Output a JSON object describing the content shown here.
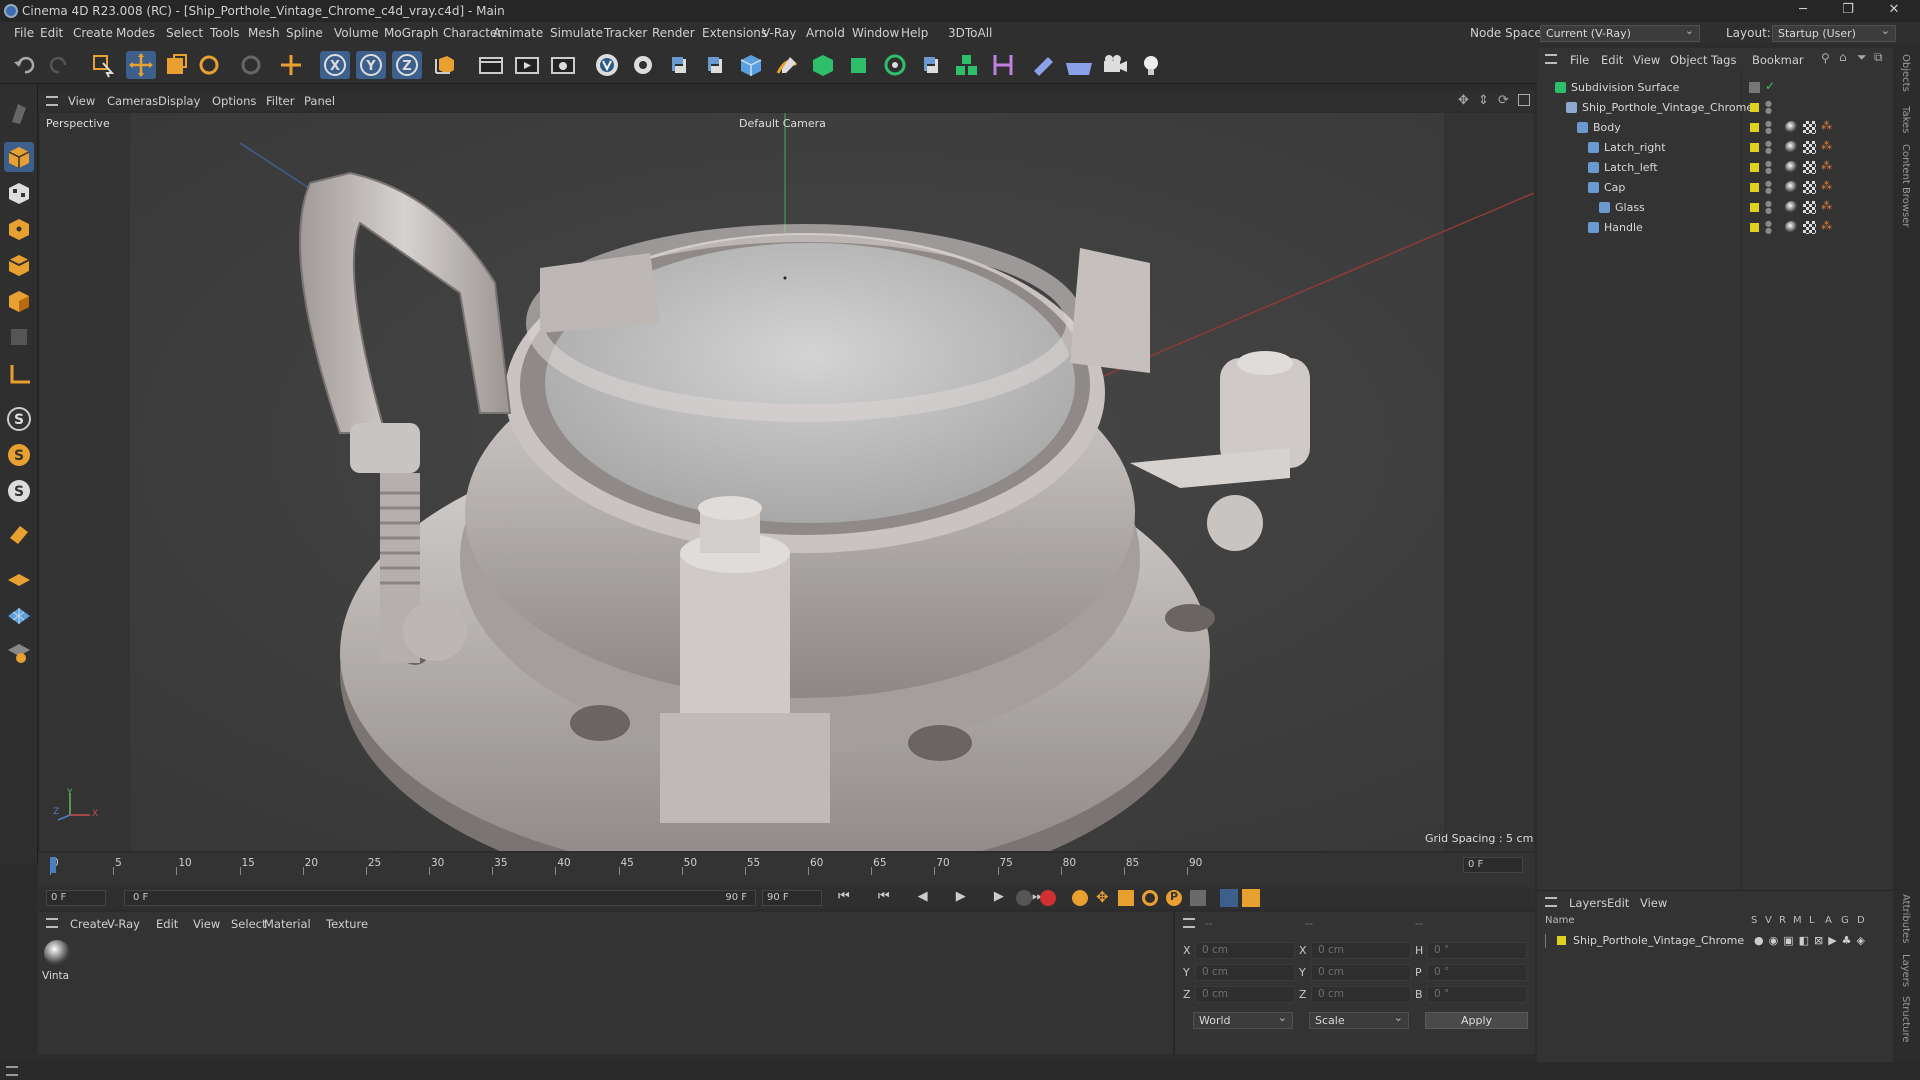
{
  "window": {
    "title": "Cinema 4D R23.008 (RC) - [Ship_Porthole_Vintage_Chrome_c4d_vray.c4d] - Main"
  },
  "menu": [
    "File",
    "Edit",
    "Create",
    "Modes",
    "Select",
    "Tools",
    "Mesh",
    "Spline",
    "Volume",
    "MoGraph",
    "Character",
    "Animate",
    "Simulate",
    "Tracker",
    "Render",
    "Extensions",
    "V-Ray",
    "Arnold",
    "Window",
    "Help",
    "3DToAll"
  ],
  "node_space": {
    "label": "Node Space:",
    "value": "Current (V-Ray)"
  },
  "layout": {
    "label": "Layout:",
    "value": "Startup (User)"
  },
  "viewport": {
    "menu": [
      "View",
      "Cameras",
      "Display",
      "Options",
      "Filter",
      "Panel"
    ],
    "view_name": "Perspective",
    "camera": "Default Camera",
    "grid_spacing": "Grid Spacing : 5 cm",
    "axis": {
      "x": "X",
      "y": "Y",
      "z": "Z"
    }
  },
  "objects": {
    "menu": [
      "File",
      "Edit",
      "View",
      "Object",
      "Tags",
      "Bookmar"
    ],
    "items": [
      {
        "name": "Subdivision Surface",
        "level": 0
      },
      {
        "name": "Ship_Porthole_Vintage_Chrome",
        "level": 1
      },
      {
        "name": "Body",
        "level": 2
      },
      {
        "name": "Latch_right",
        "level": 3
      },
      {
        "name": "Latch_left",
        "level": 3
      },
      {
        "name": "Cap",
        "level": 3
      },
      {
        "name": "Glass",
        "level": 4
      },
      {
        "name": "Handle",
        "level": 3
      }
    ]
  },
  "timeline": {
    "ticks": [
      "0",
      "5",
      "10",
      "15",
      "20",
      "25",
      "30",
      "35",
      "40",
      "45",
      "50",
      "55",
      "60",
      "65",
      "70",
      "75",
      "80",
      "85",
      "90"
    ],
    "current_frame": "0 F",
    "start": "0 F",
    "min": "0 F",
    "max": "90 F",
    "end": "90 F"
  },
  "materials": {
    "menu": [
      "Create",
      "V-Ray",
      "Edit",
      "View",
      "Select",
      "Material",
      "Texture"
    ],
    "items": [
      {
        "name": "Vinta"
      }
    ]
  },
  "coordinates": {
    "rows": [
      {
        "a": "X",
        "av": "0 cm",
        "b": "X",
        "bv": "0 cm",
        "c": "H",
        "cv": "0 °"
      },
      {
        "a": "Y",
        "av": "0 cm",
        "b": "Y",
        "bv": "0 cm",
        "c": "P",
        "cv": "0 °"
      },
      {
        "a": "Z",
        "av": "0 cm",
        "b": "Z",
        "bv": "0 cm",
        "c": "B",
        "cv": "0 °"
      }
    ],
    "header": [
      "--",
      "--",
      "--"
    ],
    "mode": "World",
    "scale": "Scale",
    "apply": "Apply"
  },
  "layers": {
    "menu": [
      "Layers",
      "Edit",
      "View"
    ],
    "cols": [
      "Name",
      "S",
      "V",
      "R",
      "M",
      "L",
      "A",
      "G",
      "D"
    ],
    "items": [
      {
        "name": "Ship_Porthole_Vintage_Chrome"
      }
    ]
  },
  "side_tabs": [
    "Objects",
    "Takes",
    "Content Browser",
    "Attributes",
    "Layers",
    "Structure"
  ],
  "colors": {
    "accent": "#4a7fc0",
    "layer": "#e0d020",
    "bg": "#2f2f2f"
  }
}
